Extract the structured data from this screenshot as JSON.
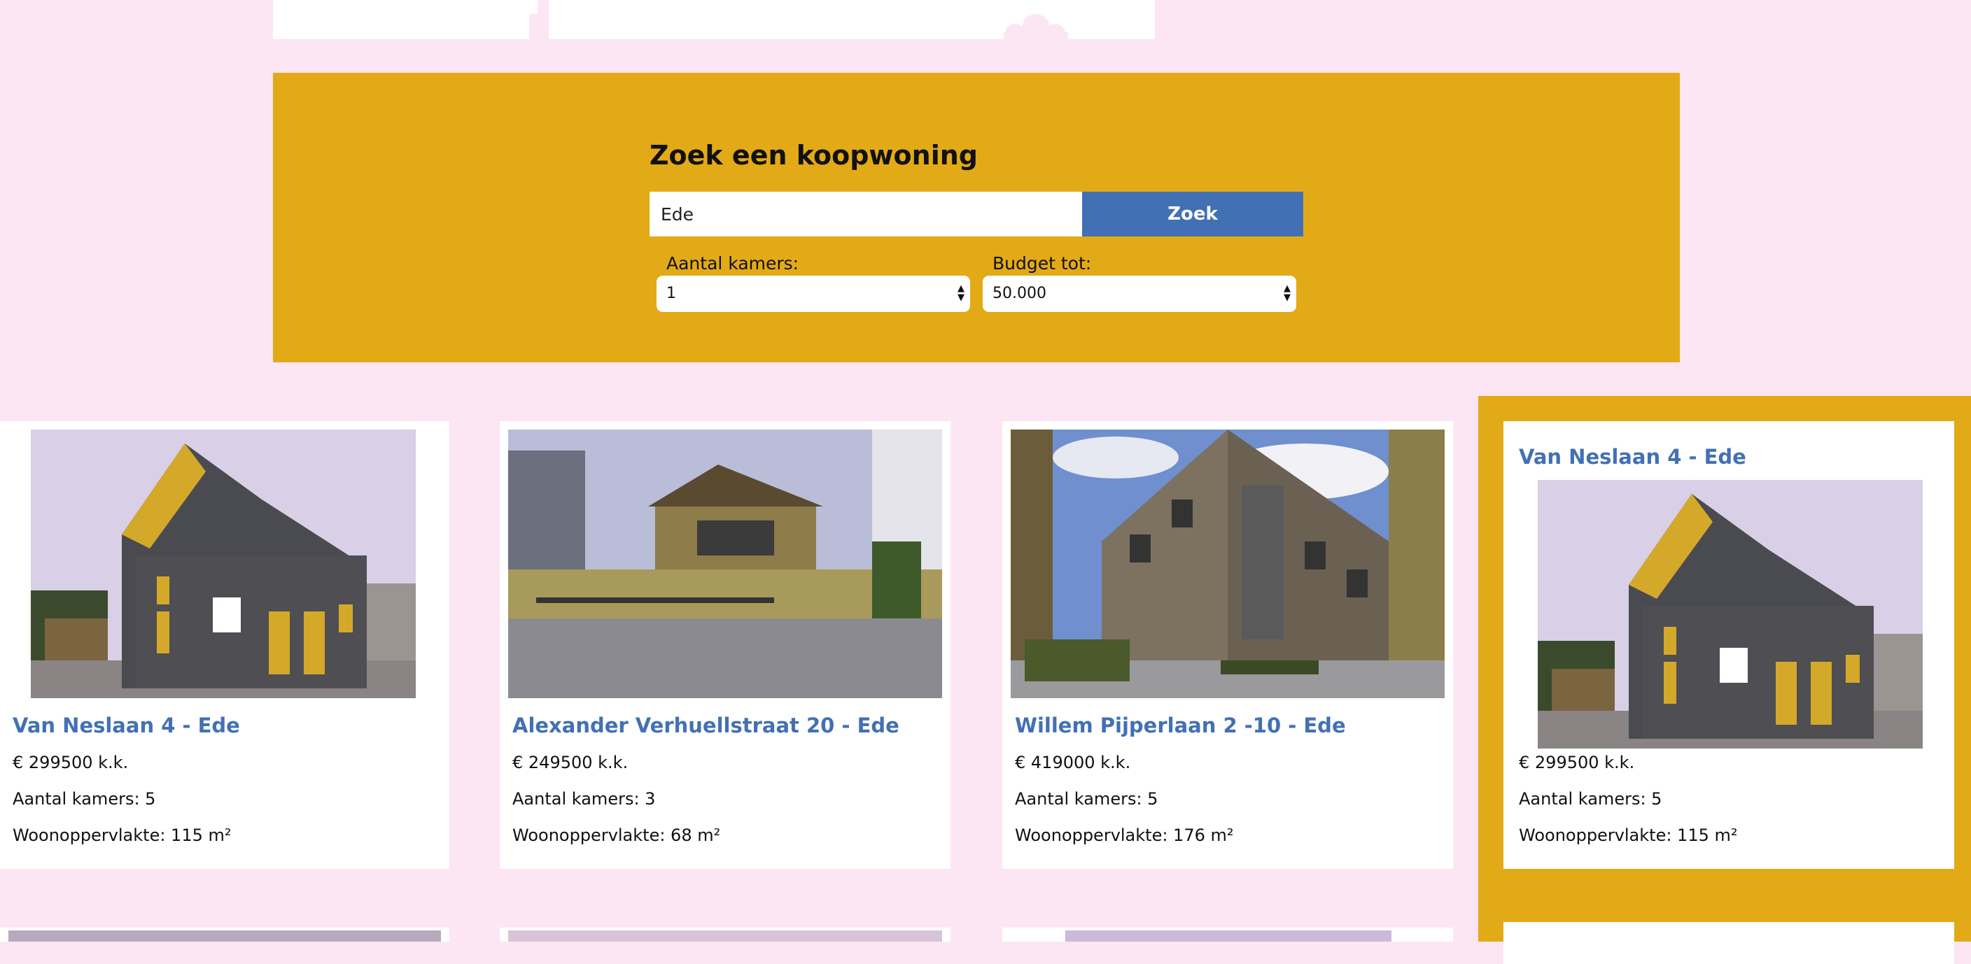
{
  "search": {
    "title": "Zoek een koopwoning",
    "query_value": "Ede",
    "button_label": "Zoek",
    "rooms_label": "Aantal kamers:",
    "rooms_value": "1",
    "budget_label": "Budget tot:",
    "budget_value": "50.000"
  },
  "listings": [
    {
      "title": "Van Neslaan 4 - Ede",
      "price": "€ 299500 k.k.",
      "rooms": "Aantal kamers: 5",
      "area": "Woonoppervlakte: 115 m²"
    },
    {
      "title": "Alexander Verhuellstraat 20 - Ede",
      "price": "€ 249500 k.k.",
      "rooms": "Aantal kamers: 3",
      "area": "Woonoppervlakte: 68 m²"
    },
    {
      "title": "Willem Pijperlaan 2 -10 - Ede",
      "price": "€ 419000 k.k.",
      "rooms": "Aantal kamers: 5",
      "area": "Woonoppervlakte: 176 m²"
    }
  ],
  "featured": {
    "title": "Van Neslaan 4 - Ede",
    "price": "€ 299500 k.k.",
    "rooms": "Aantal kamers: 5",
    "area": "Woonoppervlakte: 115 m²"
  },
  "colors": {
    "page_bg": "#fde6f3",
    "panel": "#e3aa17",
    "accent": "#4270b5"
  }
}
